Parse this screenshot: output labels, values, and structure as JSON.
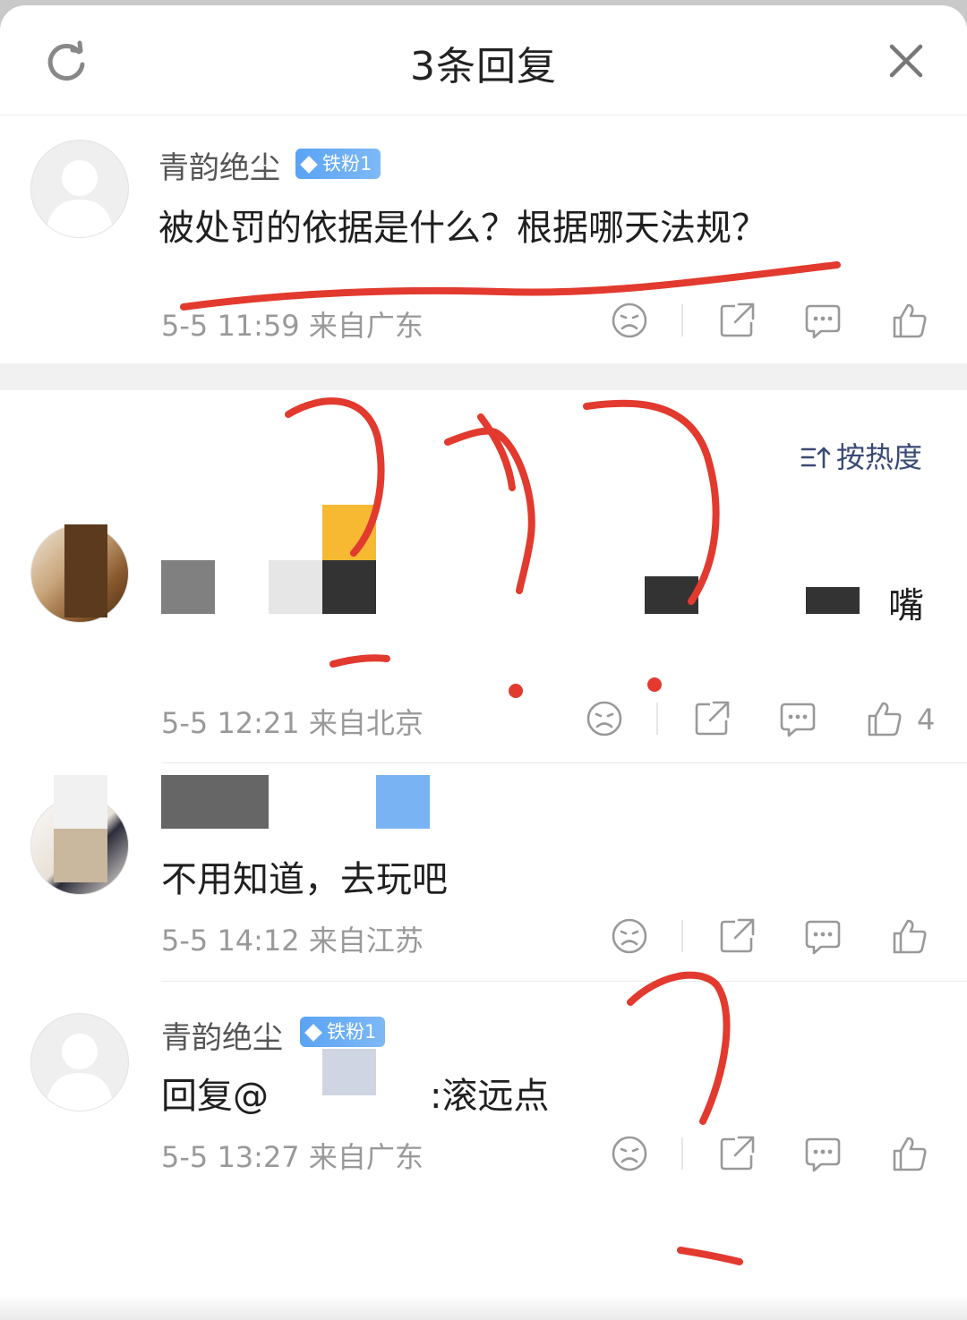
{
  "header": {
    "title": "3条回复"
  },
  "main_comment": {
    "author": "青韵绝尘",
    "badge": "铁粉1",
    "text": "被处罚的依据是什么？根据哪天法规？",
    "meta": "5-5 11:59  来自广东"
  },
  "sort": {
    "label": "按热度"
  },
  "replies": [
    {
      "author_visible": "",
      "text": "嘴",
      "meta": "5-5 12:21  来自北京",
      "likes": "4"
    },
    {
      "author_visible": "",
      "text": "不用知道，去玩吧",
      "meta": "5-5 14:12  来自江苏"
    },
    {
      "author": "青韵绝尘",
      "badge": "铁粉1",
      "text_prefix": "回复@",
      "text_suffix": ":滚远点",
      "meta": "5-5 13:27  来自广东"
    }
  ],
  "colors": {
    "accent_blue": "#5aa3f4",
    "sort_text": "#3a4a74",
    "annotation_red": "#e23a2e"
  }
}
